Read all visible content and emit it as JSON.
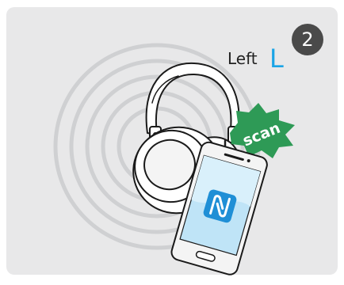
{
  "step": {
    "number": "2"
  },
  "side_label": {
    "word": "Left",
    "letter": "L"
  },
  "scan_badge": {
    "text": "scan"
  },
  "colors": {
    "panel_background": "#e8e8e9",
    "accent_blue": "#1aa4e6",
    "scan_green": "#2e9a56",
    "step_badge": "#4a4a4a",
    "nfc_blue": "#1f8fd6"
  },
  "icons": {
    "headphones": "headphones-icon",
    "phone": "smartphone-icon",
    "nfc": "nfc-icon",
    "signal": "signal-rings-icon"
  }
}
